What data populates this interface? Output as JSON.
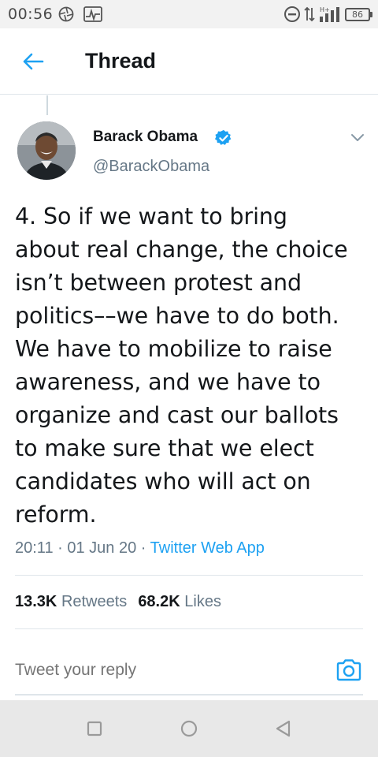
{
  "status_bar": {
    "time": "00:56",
    "battery": "86"
  },
  "header": {
    "title": "Thread",
    "back_icon": "arrow-left-icon"
  },
  "tweet": {
    "author_name": "Barack Obama",
    "author_handle": "@BarackObama",
    "verified": true,
    "text_lines": [
      "4. So if we want to bring",
      "about real change, the choice",
      "isn’t between protest and",
      "politics––we have to do both.",
      "We have to mobilize to raise",
      "awareness, and we have to",
      "organize and cast our ballots",
      "to make sure that we elect",
      "candidates who will act on",
      "reform."
    ],
    "time": "20:11",
    "date": "01 Jun 20",
    "source": "Twitter Web App",
    "separator": " · "
  },
  "stats": {
    "retweets_count": "13.3K",
    "retweets_label": "Retweets",
    "likes_count": "68.2K",
    "likes_label": "Likes"
  },
  "reply": {
    "placeholder": "Tweet your reply"
  },
  "colors": {
    "accent": "#1da1f2",
    "text": "#14171a",
    "muted": "#657786",
    "divider": "#dfe5ea"
  }
}
